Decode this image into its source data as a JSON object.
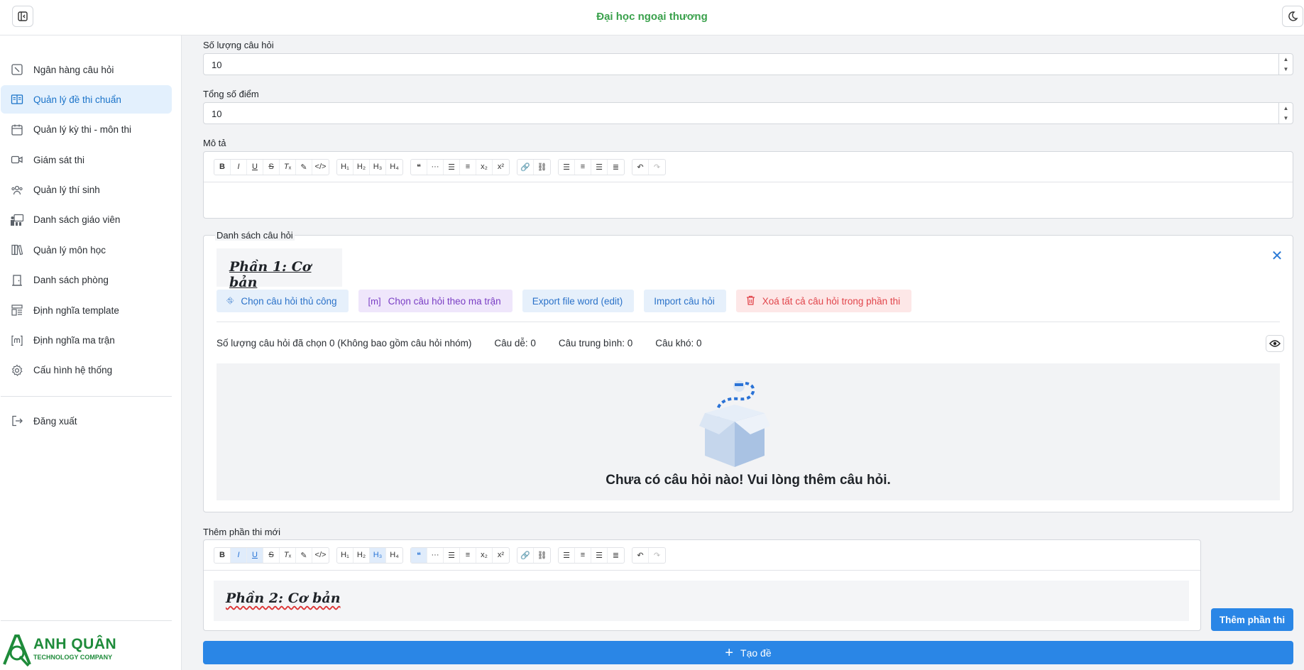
{
  "header": {
    "title": "Đại học ngoại thương"
  },
  "sidebar": {
    "items": [
      {
        "label": "Ngân hàng câu hỏi",
        "icon": "bank-icon",
        "active": false
      },
      {
        "label": "Quản lý đề thi chuẩn",
        "icon": "book-open-icon",
        "active": true
      },
      {
        "label": "Quản lý kỳ thi - môn thi",
        "icon": "calendar-icon",
        "active": false
      },
      {
        "label": "Giám sát thi",
        "icon": "video-camera-icon",
        "active": false
      },
      {
        "label": "Quản lý thí sinh",
        "icon": "users-icon",
        "active": false
      },
      {
        "label": "Danh sách giáo viên",
        "icon": "teacher-icon",
        "active": false
      },
      {
        "label": "Quản lý môn học",
        "icon": "books-icon",
        "active": false
      },
      {
        "label": "Danh sách phòng",
        "icon": "door-icon",
        "active": false
      },
      {
        "label": "Định nghĩa template",
        "icon": "layout-template-icon",
        "active": false
      },
      {
        "label": "Định nghĩa ma trận",
        "icon": "matrix-icon",
        "active": false
      },
      {
        "label": "Cấu hình hệ thống",
        "icon": "gear-icon",
        "active": false
      }
    ],
    "logout": "Đăng xuất",
    "brand": {
      "name": "ANH QUÂN",
      "tagline": "TECHNOLOGY COMPANY"
    }
  },
  "form": {
    "question_count": {
      "label": "Số lượng câu hỏi",
      "value": "10"
    },
    "total_score": {
      "label": "Tổng số điểm",
      "value": "10"
    },
    "description": {
      "label": "Mô tả",
      "value": ""
    }
  },
  "question_list": {
    "legend": "Danh sách câu hỏi",
    "part": {
      "title": "Phần 1: Cơ bản",
      "actions": {
        "manual": "Chọn câu hỏi thủ công",
        "matrix": "Chọn câu hỏi theo ma trận",
        "export": "Export file word (edit)",
        "import": "Import câu hỏi",
        "delete_all": "Xoá tất cả câu hỏi trong phần thi"
      },
      "stats": {
        "selected": "Số lượng câu hỏi đã chọn 0 (Không bao gồm câu hỏi nhóm)",
        "easy": "Câu dễ: 0",
        "medium": "Câu trung bình: 0",
        "hard": "Câu khó: 0"
      },
      "empty_message": "Chưa có câu hỏi nào! Vui lòng thêm câu hỏi."
    }
  },
  "new_part": {
    "label": "Thêm phần thi mới",
    "content": "Phần 2: Cơ bản",
    "add_button": "Thêm phần thi"
  },
  "create_button": "Tạo đề",
  "colors": {
    "accent": "#2a86e6",
    "brand_green": "#1e8b3a",
    "title_green": "#3aa14c",
    "danger": "#e1444a"
  }
}
